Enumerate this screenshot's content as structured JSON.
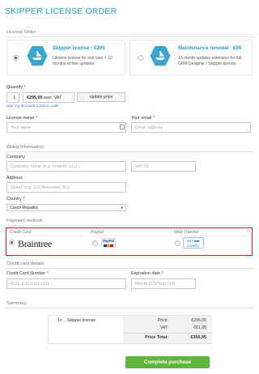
{
  "page": {
    "title": "SKIPPER LICENSE ORDER"
  },
  "license_order": {
    "heading": "License Order",
    "products": [
      {
        "title": "Skipper license - €295",
        "desc_line1": "Lifetime license for one user + 12",
        "desc_line2": "months of free updates",
        "selected": true
      },
      {
        "title": "Maintenance renewal - €99",
        "desc_line1": "12-month updates extension for full",
        "desc_line2": "ORM Designer / Skipper license.",
        "selected": false
      }
    ]
  },
  "quantity": {
    "label": "Quantity",
    "value": "1",
    "price": "€295,00",
    "vat_note": "excl. VAT",
    "update_label": "update price",
    "coupon_link": "Use my discount coupon code"
  },
  "owner": {
    "license_owner_label": "License owner",
    "license_owner_placeholder": "Your name",
    "email_label": "Your email",
    "email_placeholder": "Email address"
  },
  "billing": {
    "heading": "Billing information",
    "company_label": "Company",
    "company_placeholder": "Company name (e.g. Inventic s.r.o.)",
    "vat_placeholder": "VAT ID",
    "address_label": "Address",
    "address_placeholder": "Street (e.g. 123 Awesome St.)",
    "country_label": "Country",
    "country_value": "Czech Republic"
  },
  "payment": {
    "heading": "Payment method",
    "options": [
      {
        "name": "Credit Card",
        "logo": "Braintree",
        "selected": true
      },
      {
        "name": "Paypal",
        "logo": "PayPal",
        "selected": false
      },
      {
        "name": "Wire Transfer",
        "logo_line1": "wire ▶▶",
        "logo_line2": "transfer",
        "selected": false
      }
    ]
  },
  "card": {
    "heading": "Credit card details",
    "number_label": "Credit Card Number",
    "number_placeholder": "4111 1111 1111 1111",
    "expiry_label": "Expiration date",
    "expiry_placeholder": "Month (07)/Year (14)"
  },
  "summary": {
    "heading": "Summary",
    "item_qty": "1x",
    "item_name": "Skipper license",
    "rows": [
      {
        "label": "Price:",
        "value": "€295,00"
      },
      {
        "label": "VAT:",
        "value": "€61,95"
      }
    ],
    "total_label": "Price Total:",
    "total_value": "€356,95"
  },
  "actions": {
    "complete_label": "Complete purchase"
  },
  "colors": {
    "accent": "#2aa0c8",
    "highlight_border": "#d9141b",
    "primary_button": "#5fb63a"
  }
}
